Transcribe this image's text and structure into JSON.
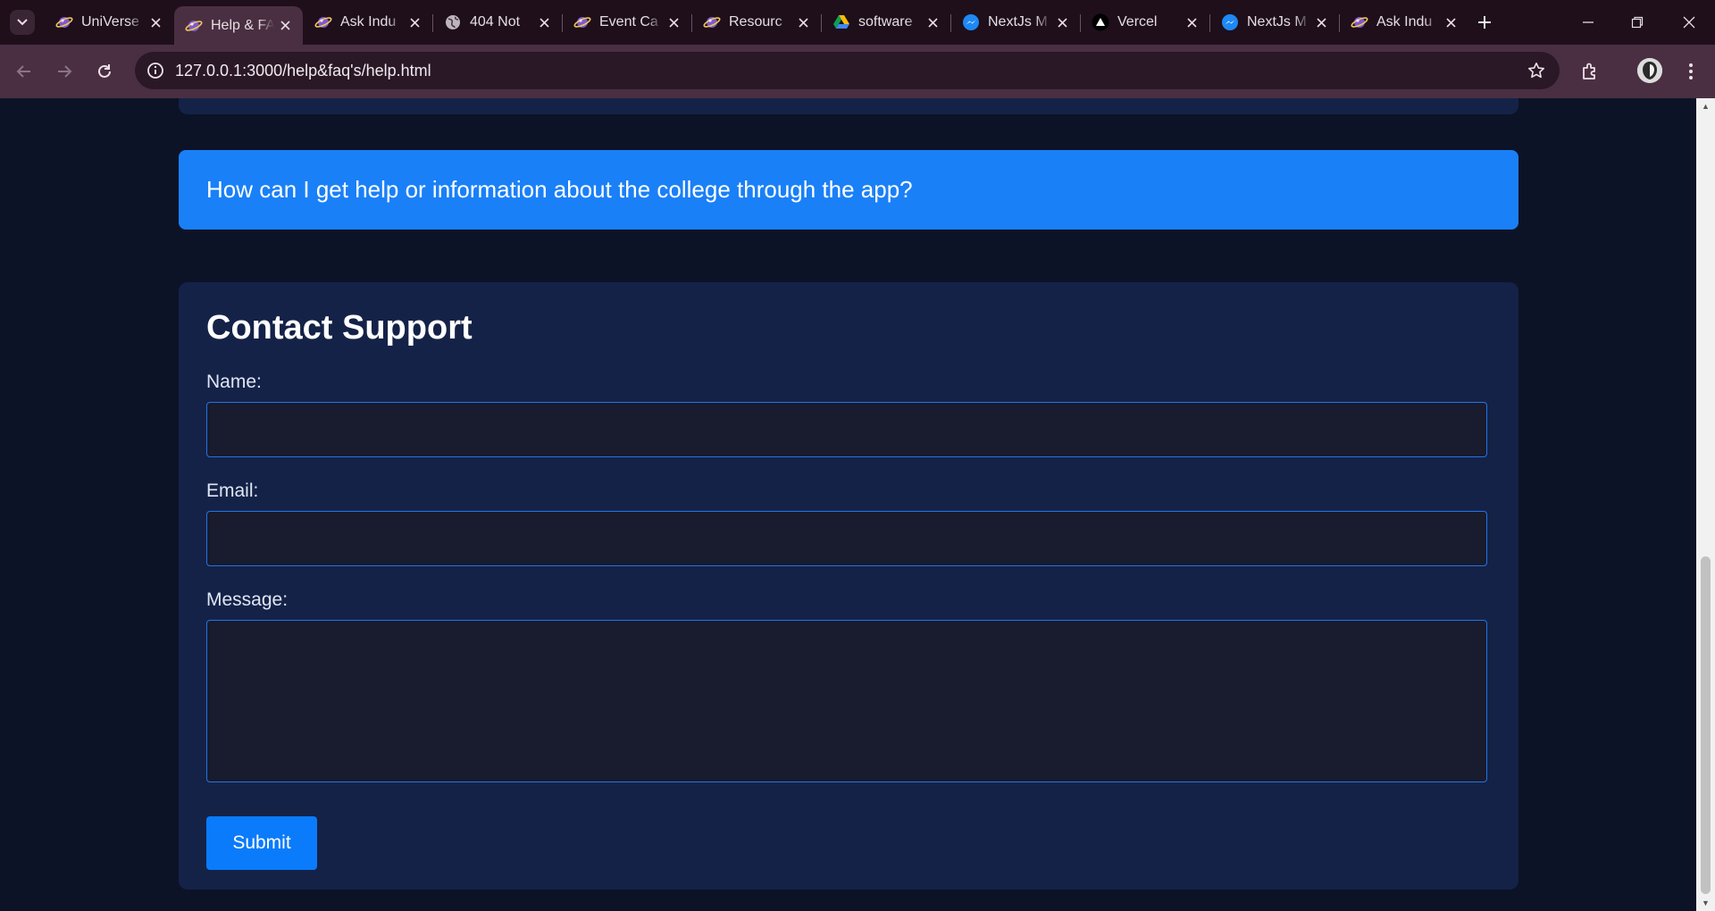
{
  "browser": {
    "tabs": [
      {
        "title": "UniVerse",
        "icon": "universe-favicon",
        "active": false
      },
      {
        "title": "Help & FAQ",
        "icon": "universe-favicon",
        "active": true
      },
      {
        "title": "Ask Indu",
        "icon": "universe-favicon",
        "active": false
      },
      {
        "title": "404 Not",
        "icon": "globe-icon",
        "active": false
      },
      {
        "title": "Event Ca",
        "icon": "universe-favicon",
        "active": false
      },
      {
        "title": "Resourc",
        "icon": "universe-favicon",
        "active": false
      },
      {
        "title": "software",
        "icon": "google-drive-icon",
        "active": false
      },
      {
        "title": "NextJs M",
        "icon": "messenger-icon",
        "active": false
      },
      {
        "title": "Vercel",
        "icon": "vercel-icon",
        "active": false
      },
      {
        "title": "NextJs M",
        "icon": "messenger-icon",
        "active": false
      },
      {
        "title": "Ask Indu",
        "icon": "universe-favicon",
        "active": false
      }
    ],
    "url": "127.0.0.1:3000/help&faq's/help.html",
    "accent": "#4a2f42"
  },
  "faq": {
    "question": "How can I get help or information about the college through the app?"
  },
  "contact": {
    "title": "Contact Support",
    "name_label": "Name:",
    "email_label": "Email:",
    "message_label": "Message:",
    "name_value": "",
    "email_value": "",
    "message_value": "",
    "submit_label": "Submit"
  },
  "colors": {
    "page_bg": "#0c1327",
    "card_bg": "#152248",
    "faq_bg": "#1a80f7",
    "button_bg": "#0a7bfb",
    "input_border": "#2274e6"
  }
}
